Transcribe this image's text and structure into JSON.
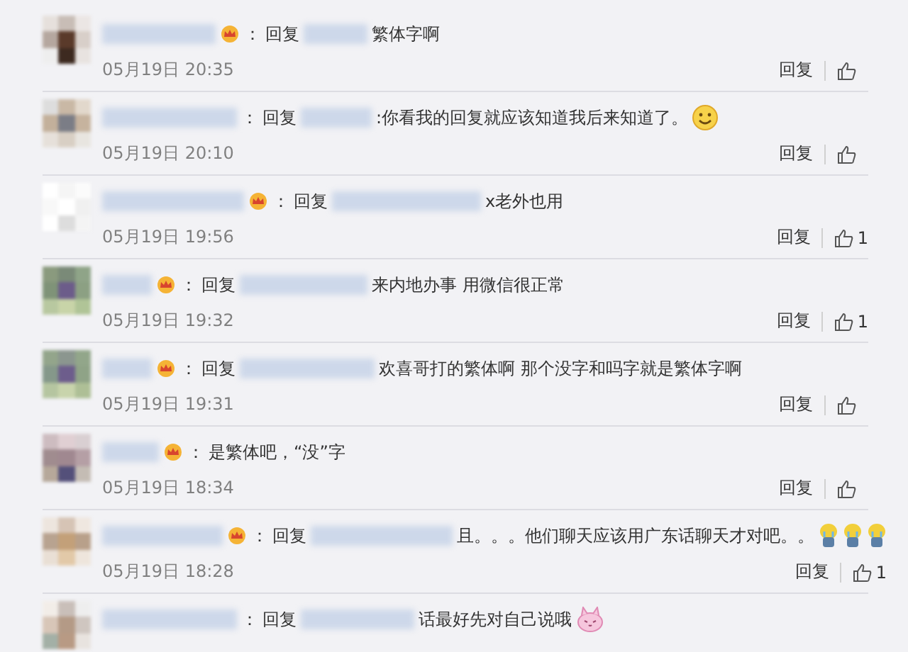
{
  "comments": [
    {
      "badge": true,
      "kind": "reply",
      "lead": "：",
      "reply_label": "回复",
      "text": "繁体字啊",
      "date": "05月19日 20:35",
      "action": "回复"
    },
    {
      "badge": false,
      "kind": "reply",
      "lead": "：",
      "reply_label": "回复",
      "text": ":你看我的回复就应该知道我后来知道了。",
      "emojis": [
        {
          "kind": "smile"
        }
      ],
      "date": "05月19日 20:10",
      "action": "回复"
    },
    {
      "badge": true,
      "kind": "reply",
      "lead": "：",
      "reply_label": "回复",
      "text": "x老外也用",
      "date": "05月19日 19:56",
      "action": "回复",
      "likes": "1"
    },
    {
      "badge": true,
      "kind": "reply",
      "lead": "：",
      "reply_label": "回复",
      "text": "来内地办事 用微信很正常",
      "date": "05月19日 19:32",
      "action": "回复",
      "likes": "1"
    },
    {
      "badge": true,
      "kind": "reply",
      "lead": "：",
      "reply_label": "回复",
      "text": "欢喜哥打的繁体啊 那个没字和吗字就是繁体字啊",
      "date": "05月19日 19:31",
      "action": "回复"
    },
    {
      "badge": true,
      "kind": "plain",
      "lead": "：",
      "text": "是繁体吧，“没”字",
      "date": "05月19日 18:34",
      "action": "回复"
    },
    {
      "badge": true,
      "kind": "reply",
      "lead": "：",
      "reply_label": "回复",
      "text": "且。。。他们聊天应该用广东话聊天才对吧。。",
      "emojis": [
        {
          "kind": "crying"
        },
        {
          "kind": "crying"
        },
        {
          "kind": "crying"
        }
      ],
      "date": "05月19日 18:28",
      "action": "回复",
      "likes": "1"
    },
    {
      "badge": false,
      "kind": "reply",
      "lead": "：",
      "reply_label": "回复",
      "text": "话最好先对自己说哦",
      "emojis": [
        {
          "kind": "bunny"
        }
      ]
    }
  ]
}
